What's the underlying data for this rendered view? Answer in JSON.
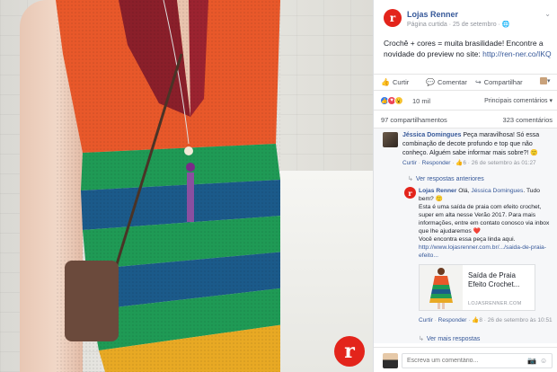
{
  "page": {
    "name": "Lojas Renner",
    "meta": "Página curtida · 25 de setembro · ",
    "logo_letter": "r",
    "post_text": "Crochê + cores = muita brasilidade! Encontre a novidade do preview no site: ",
    "post_link": "http://ren-ner.co/IKQ"
  },
  "actions": {
    "like": "Curtir",
    "comment": "Comentar",
    "share": "Compartilhar"
  },
  "reactions": {
    "count": "10 mil",
    "sort": "Principais comentários ▾",
    "shares": "97 compartilhamentos",
    "comments": "323 comentários"
  },
  "comment1": {
    "author": "Jéssica Domingues",
    "text": " Peça maravilhosa! Só essa combinação de decote profundo e top que não conheço. Alguém sabe informar mais sobre?! 🙂",
    "like": "Curtir",
    "reply": "Responder",
    "reactions": "6",
    "date": "26 de setembro às 01:27",
    "more": "Ver respostas anteriores"
  },
  "reply1": {
    "author": "Lojas Renner",
    "mention": "Jéssica Domingues",
    "greeting": " Olá, ",
    "line1": ". Tudo bem? 🙂",
    "line2": "Esta é uma saída de praia com efeito crochet, super em alta nesse Verão 2017. Para mais informações, entre em contato conosco via inbox que lhe ajudaremos ❤️",
    "line3": "Você encontra essa peça linda aqui.",
    "link": "http://www.lojasrenner.com.br/.../saida-de-praia-efeito...",
    "preview_title": "Saída de Praia Efeito Crochet...",
    "preview_domain": "LOJASRENNER.COM",
    "like": "Curtir",
    "reply": "Responder",
    "reactions": "8",
    "date": "26 de setembro às 10:51",
    "more": "Ver mais respostas"
  },
  "composer": {
    "placeholder": "Escreva um comentário..."
  },
  "colors": {
    "brand": "#e3241b",
    "link": "#365899"
  }
}
